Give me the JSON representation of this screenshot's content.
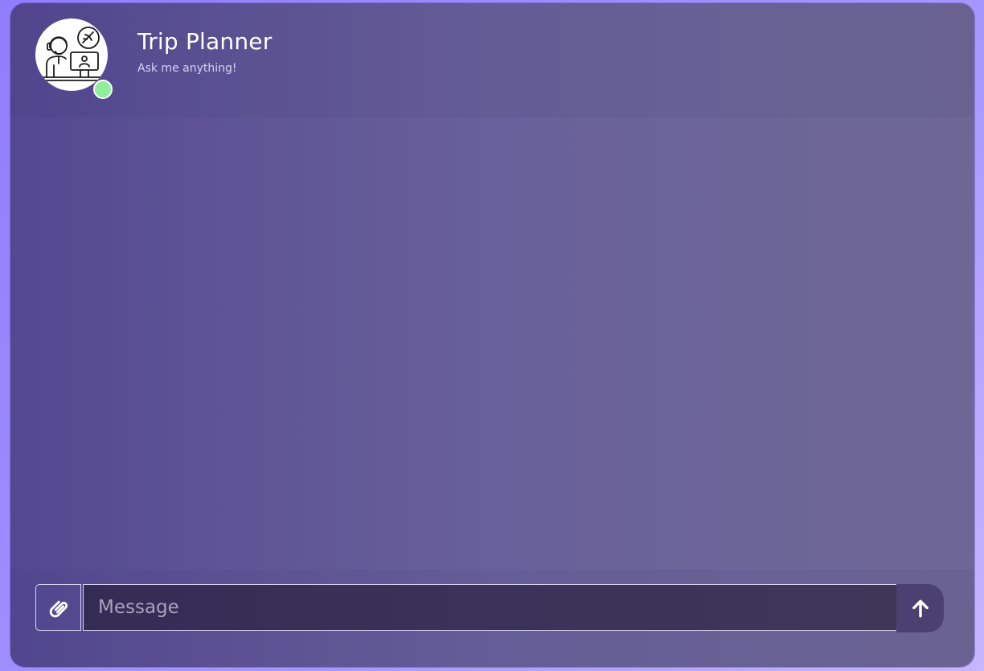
{
  "header": {
    "title": "Trip Planner",
    "subtitle": "Ask me anything!",
    "avatar_icon": "travel-agent-icon",
    "status": "online",
    "status_color": "#8fef9a"
  },
  "composer": {
    "placeholder": "Message",
    "value": "",
    "attach_icon": "paperclip-icon",
    "send_icon": "arrow-up-icon"
  },
  "colors": {
    "page_background": "#9b8bff",
    "window_background": "#625a97",
    "input_background": "#382f57",
    "send_button": "#4a4170"
  }
}
